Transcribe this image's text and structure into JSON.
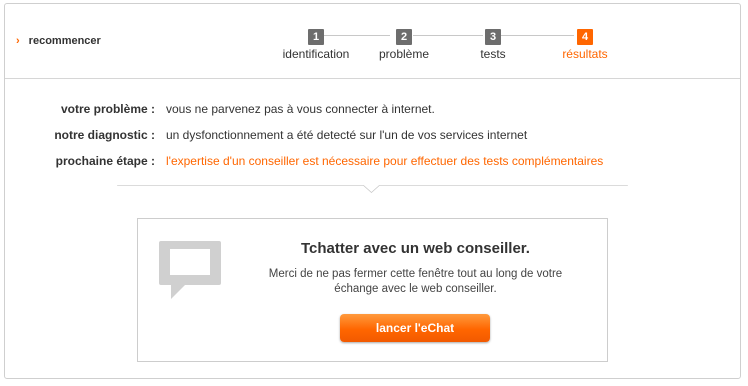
{
  "header": {
    "restart_label": "recommencer",
    "steps": [
      {
        "number": "1",
        "label": "identification"
      },
      {
        "number": "2",
        "label": "problème"
      },
      {
        "number": "3",
        "label": "tests"
      },
      {
        "number": "4",
        "label": "résultats"
      }
    ],
    "active_step": "4"
  },
  "diagnosis": {
    "problem_label": "votre problème :",
    "problem_value": "vous ne parvenez pas à vous connecter à internet.",
    "diagnostic_label": "notre diagnostic :",
    "diagnostic_value": "un dysfonctionnement a été detecté sur l'un de vos services internet",
    "next_step_label": "prochaine étape :",
    "next_step_value": "l'expertise d'un conseiller est nécessaire pour effectuer des tests complémentaires"
  },
  "chat": {
    "title": "Tchatter avec un web conseiller.",
    "description": "Merci de ne pas fermer cette fenêtre tout au long de votre échange avec le web conseiller.",
    "button_label": "lancer l'eChat",
    "icon": "chat-bubble-icon"
  },
  "colors": {
    "accent": "#ff6600",
    "step_inactive": "#6d6d6d"
  }
}
